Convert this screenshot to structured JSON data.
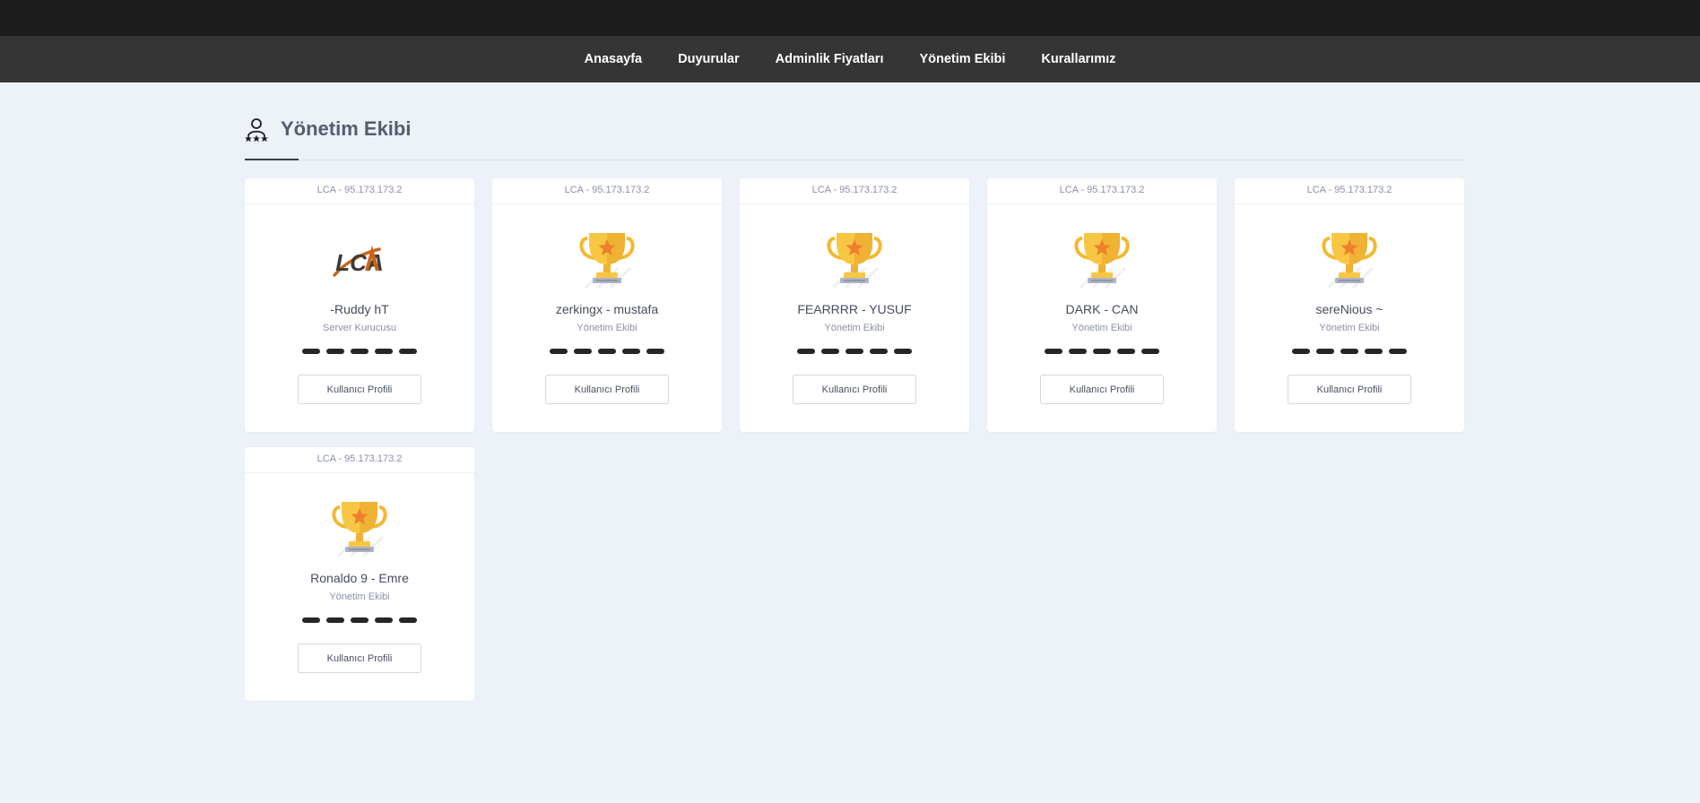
{
  "nav": {
    "items": [
      {
        "label": "Anasayfa"
      },
      {
        "label": "Duyurular"
      },
      {
        "label": "Adminlik Fiyatları"
      },
      {
        "label": "Yönetim Ekibi"
      },
      {
        "label": "Kurallarımız"
      }
    ]
  },
  "page": {
    "title": "Yönetim Ekibi",
    "icon": "user-stars-icon"
  },
  "team": [
    {
      "server": "LCA - 95.173.173.2",
      "name": "-Ruddy hT",
      "role": "Server Kurucusu",
      "image": "lca-logo",
      "button": "Kullanıcı Profili"
    },
    {
      "server": "LCA - 95.173.173.2",
      "name": "zerkingx - mustafa",
      "role": "Yönetim Ekibi",
      "image": "trophy-icon",
      "button": "Kullanıcı Profili"
    },
    {
      "server": "LCA - 95.173.173.2",
      "name": "FEARRRR - YUSUF",
      "role": "Yönetim Ekibi",
      "image": "trophy-icon",
      "button": "Kullanıcı Profili"
    },
    {
      "server": "LCA - 95.173.173.2",
      "name": "DARK - CAN",
      "role": "Yönetim Ekibi",
      "image": "trophy-icon",
      "button": "Kullanıcı Profili"
    },
    {
      "server": "LCA - 95.173.173.2",
      "name": "sereNious ~",
      "role": "Yönetim Ekibi",
      "image": "trophy-icon",
      "button": "Kullanıcı Profili"
    },
    {
      "server": "LCA - 95.173.173.2",
      "name": "Ronaldo 9 - Emre",
      "role": "Yönetim Ekibi",
      "image": "trophy-icon",
      "button": "Kullanıcı Profili"
    }
  ],
  "colors": {
    "topbar": "#1c1c1c",
    "navbar": "#353535",
    "background": "#edf1f8",
    "logo_orange": "#c8641a",
    "trophy_gold": "#f7c744"
  }
}
